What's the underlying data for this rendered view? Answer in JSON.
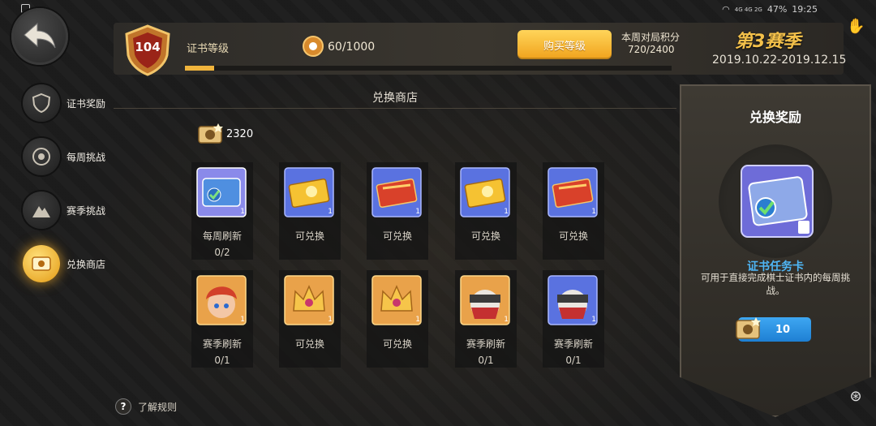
{
  "status_bar": {
    "network": "4G 4G 2G",
    "battery": "47%",
    "time": "19:25"
  },
  "header": {
    "level": "104",
    "cert_label": "证书等级",
    "xp_text": "60/1000",
    "xp_progress": 0.06,
    "buy_button": "购买等级",
    "weekly_label": "本周对局积分",
    "weekly_value": "720/2400",
    "season_title": "第3赛季",
    "season_dates": "2019.10.22-2019.12.15"
  },
  "sidebar": {
    "items": [
      {
        "label": "证书奖励",
        "icon": "shield-icon",
        "active": false
      },
      {
        "label": "每周挑战",
        "icon": "target-icon",
        "active": false
      },
      {
        "label": "赛季挑战",
        "icon": "mountain-icon",
        "active": false
      },
      {
        "label": "兑换商店",
        "icon": "ticket-icon",
        "active": true
      }
    ]
  },
  "shop": {
    "title": "兑换商店",
    "currency_amount": "2320",
    "items": [
      {
        "name": "每周刷新",
        "count": "0/2",
        "qty": "1",
        "icon": "task-card-icon"
      },
      {
        "name": "可兑换",
        "count": "",
        "qty": "1",
        "icon": "gold-ticket-icon"
      },
      {
        "name": "可兑换",
        "count": "",
        "qty": "1",
        "icon": "red-ticket-icon"
      },
      {
        "name": "可兑换",
        "count": "",
        "qty": "1",
        "icon": "gold-ticket-icon"
      },
      {
        "name": "可兑换",
        "count": "",
        "qty": "1",
        "icon": "red-ticket-icon"
      },
      {
        "name": "赛季刷新",
        "count": "0/1",
        "qty": "1",
        "icon": "hero-red-hair-icon"
      },
      {
        "name": "可兑换",
        "count": "",
        "qty": "1",
        "icon": "crown-icon"
      },
      {
        "name": "可兑换",
        "count": "",
        "qty": "1",
        "icon": "crown-icon"
      },
      {
        "name": "赛季刷新",
        "count": "0/1",
        "qty": "1",
        "icon": "ninja-icon"
      },
      {
        "name": "赛季刷新",
        "count": "0/1",
        "qty": "1",
        "icon": "ninja-icon"
      }
    ]
  },
  "panel": {
    "title": "兑换奖励",
    "item_name": "证书任务卡",
    "description": "可用于直接完成棋士证书内的每周挑战。",
    "price": "10"
  },
  "rules": {
    "icon_glyph": "?",
    "label": "了解规则"
  },
  "colors": {
    "accent_gold": "#f0b43c",
    "item_name_blue": "#4fb6f5",
    "button_blue": "#2a93e2"
  }
}
